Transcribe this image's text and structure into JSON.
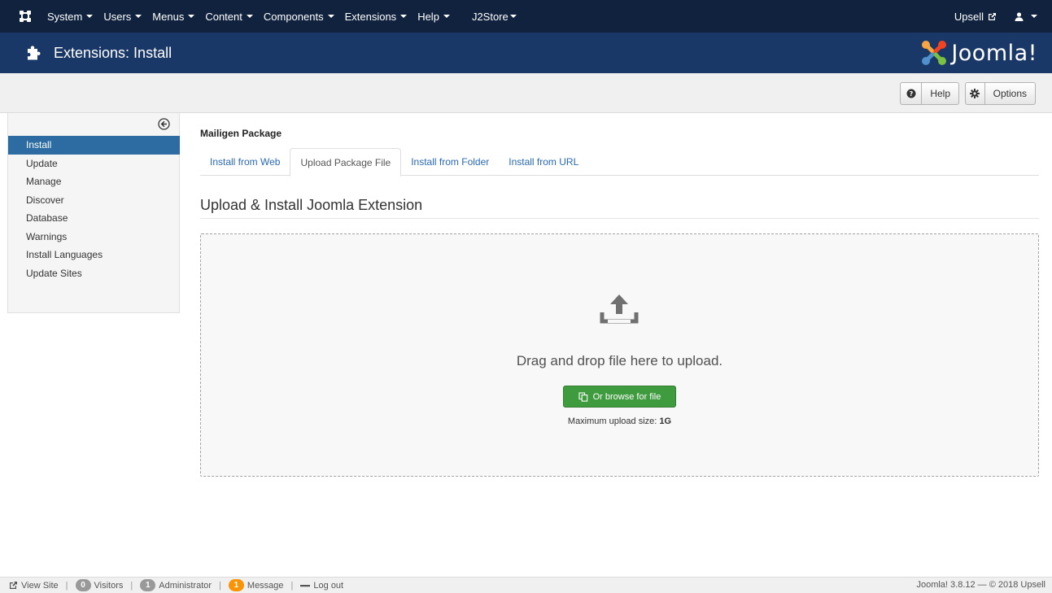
{
  "navbar": {
    "menu": [
      {
        "label": "System"
      },
      {
        "label": "Users"
      },
      {
        "label": "Menus"
      },
      {
        "label": "Content"
      },
      {
        "label": "Components"
      },
      {
        "label": "Extensions"
      },
      {
        "label": "Help"
      }
    ],
    "j2store": "J2Store",
    "upsell": "Upsell"
  },
  "header": {
    "title": "Extensions: Install",
    "brand": "Joomla!"
  },
  "toolbar": {
    "help_label": "Help",
    "options_label": "Options"
  },
  "sidebar": {
    "items": [
      {
        "label": "Install",
        "active": true
      },
      {
        "label": "Update"
      },
      {
        "label": "Manage"
      },
      {
        "label": "Discover"
      },
      {
        "label": "Database"
      },
      {
        "label": "Warnings"
      },
      {
        "label": "Install Languages"
      },
      {
        "label": "Update Sites"
      }
    ]
  },
  "main": {
    "package_title": "Mailigen Package",
    "tabs": [
      {
        "label": "Install from Web"
      },
      {
        "label": "Upload Package File",
        "active": true
      },
      {
        "label": "Install from Folder"
      },
      {
        "label": "Install from URL"
      }
    ],
    "section_title": "Upload & Install Joomla Extension",
    "drop_text": "Drag and drop file here to upload.",
    "browse_label": "Or browse for file",
    "max_size_label": "Maximum upload size: ",
    "max_size_value": "1G"
  },
  "statusbar": {
    "view_site": "View Site",
    "visitors_count": "0",
    "visitors_label": "Visitors",
    "admin_count": "1",
    "admin_label": "Administrator",
    "message_count": "1",
    "message_label": "Message",
    "logout": "Log out",
    "copyright": "Joomla! 3.8.12 — © 2018 Upsell"
  },
  "colors": {
    "navbar_bg": "#10223e",
    "header_bg": "#1a3867",
    "active_blue": "#2d6ca2",
    "link_blue": "#2a69b8",
    "browse_green": "#3e9b3e",
    "badge_orange": "#f89406"
  }
}
